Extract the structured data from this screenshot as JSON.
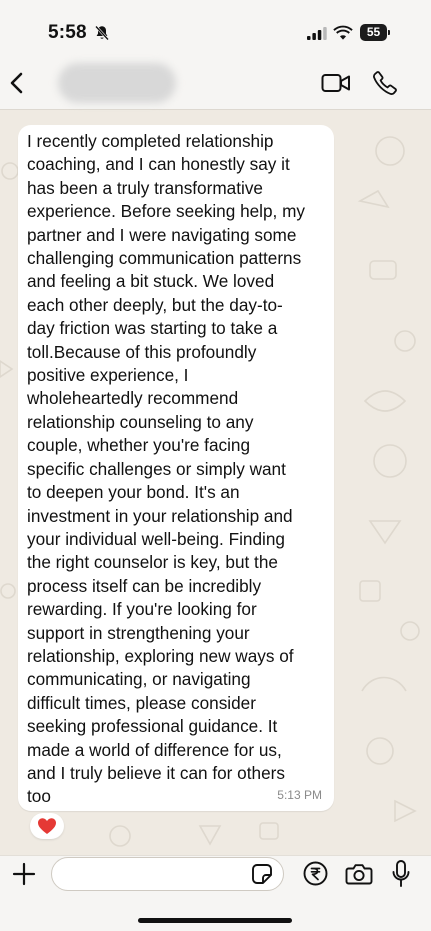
{
  "status_bar": {
    "time": "5:58",
    "battery": "55",
    "icons": [
      "bell-slash-icon",
      "cellular-signal-icon",
      "wifi-icon",
      "battery-icon"
    ]
  },
  "header": {
    "contact_name": "",
    "icons": [
      "chevron-left-icon",
      "video-call-icon",
      "phone-icon"
    ]
  },
  "messages": [
    {
      "text": "I recently completed relationship\n coaching, and I can honestly say it\nhas been a truly transformative\nexperience. Before seeking help, my\npartner and I were navigating some\nchallenging communication patterns\nand feeling a bit stuck. We loved\neach other deeply, but the day-to-\nday friction was starting to take a\ntoll.Because of this profoundly\npositive experience, I\nwholeheartedly recommend\nrelationship counseling to any\ncouple, whether you're facing\nspecific challenges or simply want\nto deepen your bond. It's an\ninvestment in your relationship and\nyour individual well-being. Finding\nthe right counselor is key, but the\nprocess itself can be incredibly\nrewarding. If you're looking for\nsupport in strengthening your\nrelationship, exploring new ways of\ncommunicating, or navigating\ndifficult times, please consider\nseeking professional guidance. It\nmade a world of difference for us,\nand I truly believe it can for others\ntoo",
      "time": "5:13 PM",
      "reaction": "heart-icon"
    }
  ],
  "composer": {
    "input_value": "",
    "input_placeholder": "",
    "icons": [
      "plus-icon",
      "sticker-icon",
      "rupee-payment-icon",
      "camera-icon",
      "microphone-icon"
    ]
  },
  "colors": {
    "chat_background": "#efeae2",
    "bubble": "#ffffff",
    "bar_background": "#f6f5f3",
    "heart": "#e53935"
  }
}
